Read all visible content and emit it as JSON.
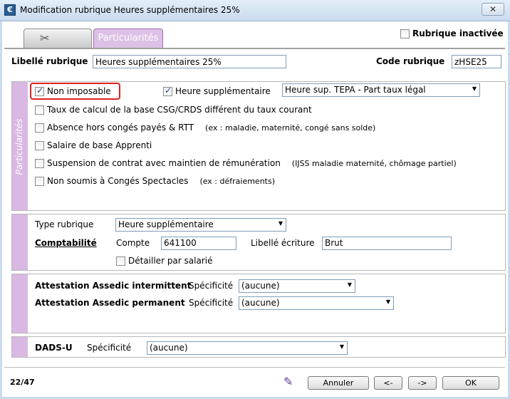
{
  "window": {
    "title": "Modification rubrique Heures supplémentaires 25%",
    "close": "✕"
  },
  "tabs": [
    {
      "label": ""
    },
    {
      "label": "Particularités"
    }
  ],
  "rubrique_inactivee": {
    "label": "Rubrique inactivée",
    "checked": false
  },
  "libelle": {
    "label": "Libellé rubrique",
    "value": "Heures supplémentaires 25%"
  },
  "code": {
    "label": "Code rubrique",
    "value": "zHSE25"
  },
  "particularites": {
    "title": "Particularités",
    "non_imposable": {
      "label": "Non imposable",
      "checked": true
    },
    "heure_sup": {
      "label": "Heure supplémentaire",
      "checked": true,
      "select": "Heure sup. TEPA - Part taux légal"
    },
    "taux_csg": {
      "label": "Taux de calcul de la base CSG/CRDS différent du taux courant",
      "checked": false
    },
    "absence": {
      "label": "Absence hors congés payés & RTT",
      "note": "(ex : maladie, maternité, congé sans solde)",
      "checked": false
    },
    "salaire_apprenti": {
      "label": "Salaire de base Apprenti",
      "checked": false
    },
    "suspension": {
      "label": "Suspension de contrat avec maintien de rémunération",
      "note": "(IJSS maladie maternité, chômage partiel)",
      "checked": false
    },
    "conges_spectacles": {
      "label": "Non soumis à Congés Spectacles",
      "note": "(ex : défraiements)",
      "checked": false
    }
  },
  "type_rubrique": {
    "label": "Type rubrique",
    "value": "Heure supplémentaire"
  },
  "comptabilite": {
    "label": "Comptabilité",
    "compte_label": "Compte",
    "compte_value": "641100",
    "libelle_label": "Libellé écriture",
    "libelle_value": "Brut",
    "detail_label": "Détailler par salarié",
    "detail_checked": false
  },
  "assedic": {
    "intermittent": {
      "label": "Attestation Assedic intermittent",
      "spec_label": "Spécificité",
      "value": "(aucune)"
    },
    "permanent": {
      "label": "Attestation Assedic permanent",
      "spec_label": "Spécificité",
      "value": "(aucune)"
    }
  },
  "dads": {
    "label": "DADS-U",
    "spec_label": "Spécificité",
    "value": "(aucune)"
  },
  "footer": {
    "page": "22/47",
    "annuler": "Annuler",
    "prev": "<-",
    "next": "->",
    "ok": "OK"
  }
}
